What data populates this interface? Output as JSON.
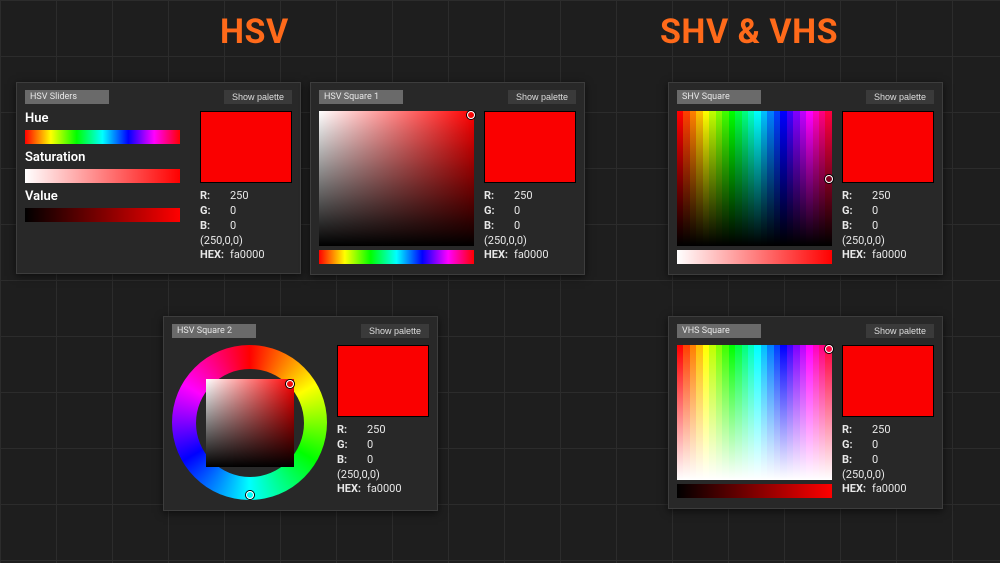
{
  "headings": {
    "left": "HSV",
    "right": "SHV & VHS"
  },
  "buttons": {
    "show_palette": "Show palette"
  },
  "rgb_labels": {
    "r": "R:",
    "g": "G:",
    "b": "B:",
    "hex": "HEX:"
  },
  "color": {
    "r": 250,
    "g": 0,
    "b": 0,
    "tuple": "(250,0,0)",
    "hex": "fa0000",
    "css": "#fa0000"
  },
  "panels": {
    "sliders": {
      "title": "HSV Sliders",
      "labels": {
        "hue": "Hue",
        "saturation": "Saturation",
        "value": "Value"
      }
    },
    "sq1": {
      "title": "HSV Square 1"
    },
    "sq2": {
      "title": "HSV Square 2"
    },
    "shv": {
      "title": "SHV Square"
    },
    "vhs": {
      "title": "VHS Square"
    }
  }
}
